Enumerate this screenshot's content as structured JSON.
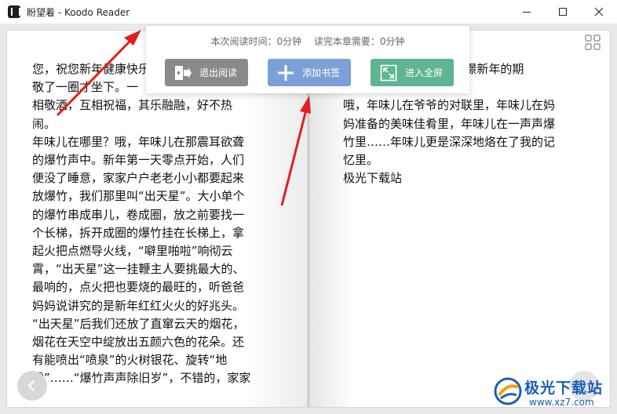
{
  "window": {
    "title": "盼望着 - Koodo Reader"
  },
  "popup": {
    "reading_time": "本次阅读时间：0分钟",
    "chapter_remaining": "读完本章需要：0分钟",
    "exit_label": "退出阅读",
    "bookmark_label": "添加书签",
    "fullscreen_label": "进入全屏"
  },
  "pages": {
    "left_lines": [
      "您，祝您新年健康快乐",
      "敬了一圈才坐下。一",
      "相敬酒，互相祝福，其乐融融，好不热",
      "闹。",
      "年味儿在哪里？哦，年味儿在那震耳欲聋",
      "的爆竹声中。新年第一天零点开始，人们",
      "便没了睡意，家家户户老老小小都要起来",
      "放爆竹，我们那里叫“出天星”。大小单个",
      "的爆竹串成串儿，卷成圈，放之前要找一",
      "个长梯，拆开成圈的爆竹挂在长梯上，拿",
      "起火把点燃导火线，“噼里啪啦”响彻云",
      "霄，“出天星”这一挂鞭主人要挑最大的、",
      "最响的，点火把也要烧的最旺的，听爸爸",
      "妈妈说讲究的是新年红红火火的好兆头。",
      "“出天星”后我们还放了直窜云天的烟花，",
      "烟花在天空中绽放出五颜六色的花朵。还",
      "有能喷出“喷泉”的火树银花、旋转“地",
      "雷”……“爆竹声声除旧岁”，不错的，家家"
    ],
    "right_lines": [
      "                    爆竹来憧憬新年的期",
      "",
      "哦，年味儿在爷爷的对联里，年味儿在妈",
      "妈准备的美味佳肴里，年味儿在一声声爆",
      "竹里……年味儿更是深深地烙在了我的记",
      "忆里。",
      "极光下载站"
    ]
  },
  "watermark": {
    "title": "极光下载站",
    "url": "www.xz7.com"
  },
  "colors": {
    "exit_button": "#8a8a8a",
    "bookmark_button": "#7ba0d8",
    "fullscreen_button": "#5fb491",
    "annotation_arrow": "#e02020"
  }
}
